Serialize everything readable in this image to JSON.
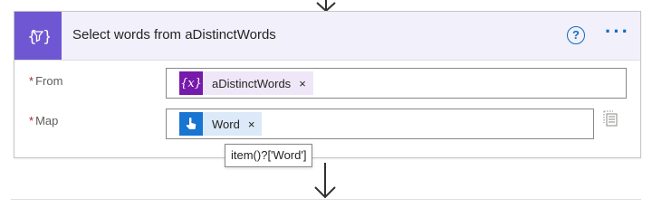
{
  "action": {
    "title": "Select words from aDistinctWords",
    "help_label": "?",
    "more_label": "···",
    "icon": "select-action-icon",
    "accent_color": "#6f57d3"
  },
  "fields": {
    "from": {
      "required_marker": "*",
      "label": "From",
      "token": {
        "icon": "variable-icon",
        "icon_glyph": "{x}",
        "text": "aDistinctWords",
        "remove": "×",
        "color": "#7719aa"
      }
    },
    "map": {
      "required_marker": "*",
      "label": "Map",
      "token": {
        "icon": "manual-trigger-icon",
        "text": "Word",
        "remove": "×",
        "color": "#1875d1"
      },
      "switch_icon": "switch-map-mode-icon"
    }
  },
  "tooltip": {
    "text": "item()?['Word']"
  }
}
